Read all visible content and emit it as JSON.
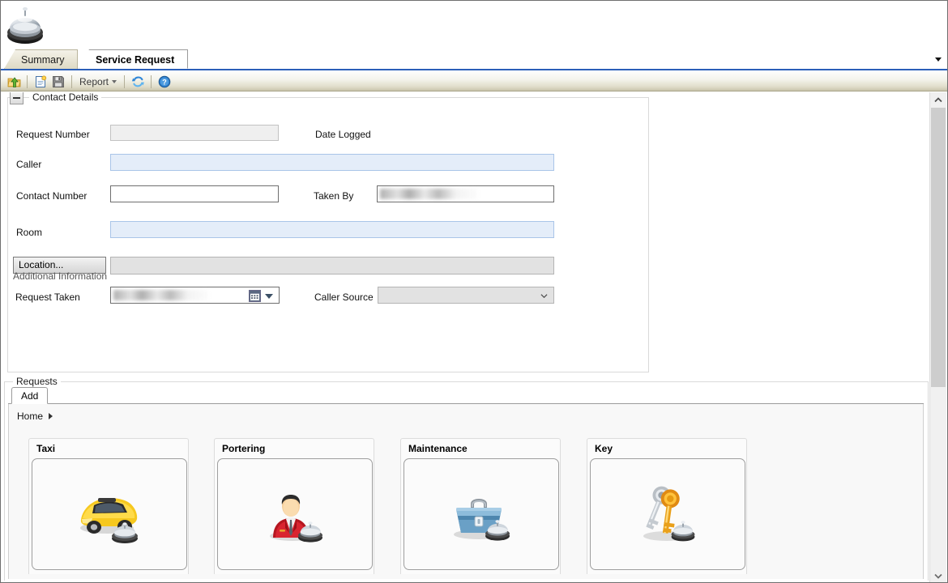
{
  "app": {
    "logo_icon": "service-bell-icon"
  },
  "tabs": {
    "items": [
      {
        "label": "Summary",
        "active": false
      },
      {
        "label": "Service Request",
        "active": true
      }
    ],
    "overflow_icon": "chevron-down-icon"
  },
  "toolbar": {
    "buttons": [
      {
        "name": "open-button",
        "icon": "open-folder-icon"
      },
      {
        "name": "new-button",
        "icon": "new-document-icon"
      },
      {
        "name": "save-button",
        "icon": "save-floppy-icon"
      },
      {
        "name": "refresh-button",
        "icon": "refresh-icon"
      },
      {
        "name": "help-button",
        "icon": "help-question-icon"
      }
    ],
    "report_label": "Report",
    "report_caret_icon": "caret-down-icon"
  },
  "contact_details": {
    "legend": "Contact Details",
    "collapse_icon": "minus-icon",
    "fields": {
      "request_number_label": "Request Number",
      "request_number_value": "",
      "date_logged_label": "Date Logged",
      "date_logged_value": "",
      "caller_label": "Caller",
      "caller_value": "",
      "contact_number_label": "Contact Number",
      "contact_number_value": "",
      "taken_by_label": "Taken By",
      "taken_by_value": "",
      "room_label": "Room",
      "room_value": "",
      "location_button_label": "Location...",
      "location_value": "",
      "additional_information_label": "Additional Information",
      "request_taken_label": "Request Taken",
      "request_taken_value": "",
      "request_taken_calendar_icon": "calendar-icon",
      "request_taken_caret_icon": "caret-down-icon",
      "caller_source_label": "Caller Source",
      "caller_source_value": "",
      "caller_source_chevron_icon": "chevron-down-icon"
    }
  },
  "requests": {
    "legend": "Requests",
    "tabs": [
      {
        "label": "Add",
        "active": true
      }
    ],
    "breadcrumb": {
      "items": [
        "Home"
      ],
      "separator_icon": "caret-right-icon"
    },
    "cards": [
      {
        "title": "Taxi",
        "icon": "taxi-car-icon"
      },
      {
        "title": "Portering",
        "icon": "porter-person-icon"
      },
      {
        "title": "Maintenance",
        "icon": "toolbox-icon"
      },
      {
        "title": "Key",
        "icon": "keys-icon"
      }
    ]
  },
  "scrollbar": {
    "up_icon": "chevron-up-icon",
    "down_icon": "chevron-down-icon"
  },
  "colors": {
    "accent": "#2b5fb8",
    "required_field": "#e4edf9",
    "toolbar_gradient_end": "#c9c5ac"
  }
}
